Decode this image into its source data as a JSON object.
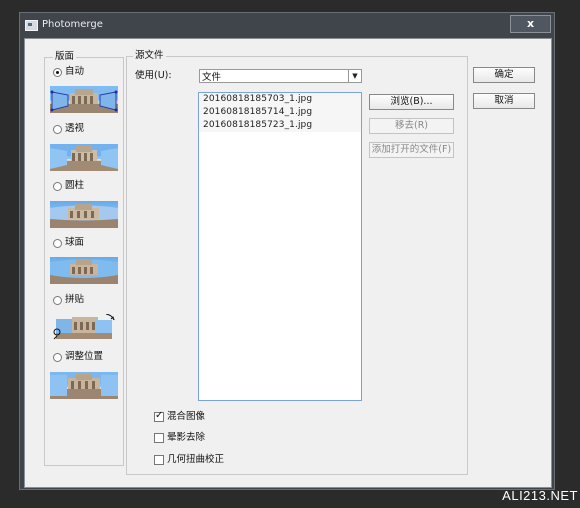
{
  "window": {
    "title": "Photomerge",
    "close_label": "x"
  },
  "layout": {
    "group_title": "版面",
    "options": [
      {
        "label": "自动",
        "selected": true
      },
      {
        "label": "透视",
        "selected": false
      },
      {
        "label": "圆柱",
        "selected": false
      },
      {
        "label": "球面",
        "selected": false
      },
      {
        "label": "拼贴",
        "selected": false
      },
      {
        "label": "调整位置",
        "selected": false
      }
    ]
  },
  "source_files": {
    "group_title": "源文件",
    "use_label": "使用(U):",
    "use_value": "文件",
    "files": [
      "20160818185703_1.jpg",
      "20160818185714_1.jpg",
      "20160818185723_1.jpg"
    ],
    "buttons": {
      "browse": "浏览(B)...",
      "remove": "移去(R)",
      "add_open": "添加打开的文件(F)"
    },
    "checkboxes": [
      {
        "label": "混合图像",
        "checked": true
      },
      {
        "label": "晕影去除",
        "checked": false
      },
      {
        "label": "几何扭曲校正",
        "checked": false
      }
    ]
  },
  "dialog_buttons": {
    "ok": "确定",
    "cancel": "取消"
  },
  "watermark": "ALI213.NET",
  "colors": {
    "window_bg": "#40454b",
    "client_bg": "#f0f0f0",
    "list_border": "#7aa4d8"
  }
}
